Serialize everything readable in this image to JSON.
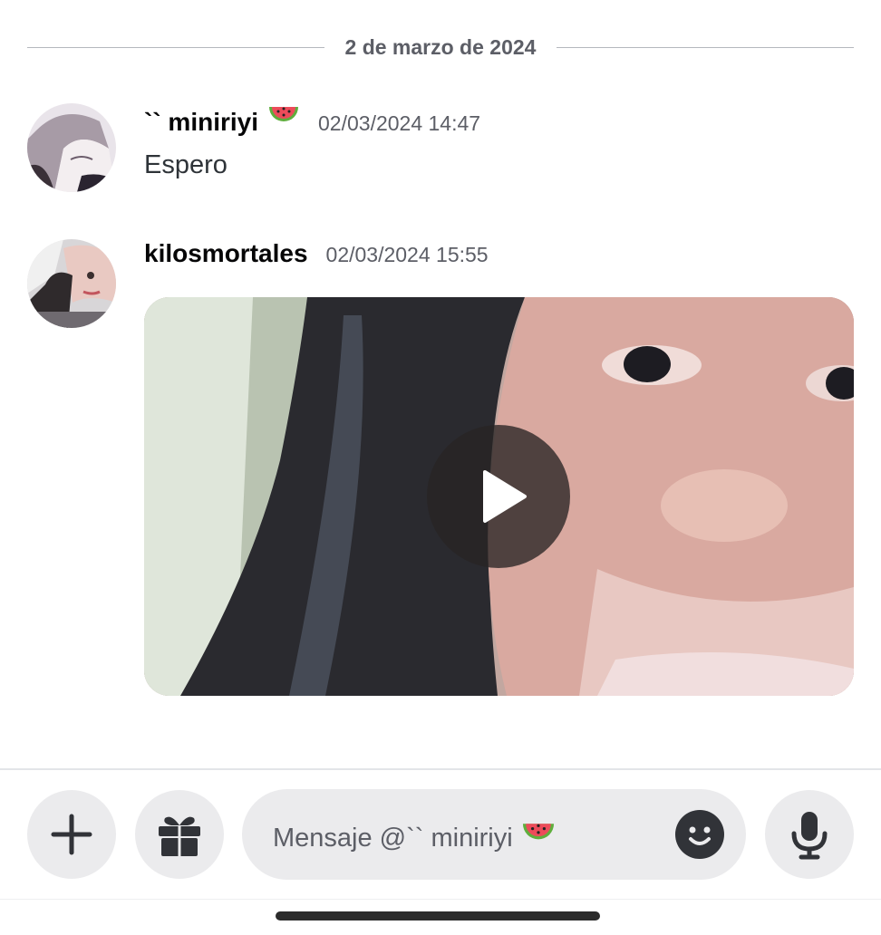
{
  "date_divider": {
    "label": "2 de marzo de 2024"
  },
  "messages": [
    {
      "username": "`` miniriyi",
      "username_emoji": "watermelon-emoji",
      "timestamp": "02/03/2024 14:47",
      "text": "Espero"
    },
    {
      "username": "kilosmortales",
      "timestamp": "02/03/2024 15:55",
      "attachment": {
        "type": "video",
        "play_icon": "play-icon"
      }
    }
  ],
  "composer": {
    "add_icon": "plus-icon",
    "gift_icon": "gift-icon",
    "placeholder": "Mensaje @`` miniriyi",
    "placeholder_emoji": "watermelon-emoji",
    "emoji_icon": "smiley-icon",
    "mic_icon": "microphone-icon"
  },
  "colors": {
    "background": "#ffffff",
    "button_bg": "#ebebed",
    "muted_text": "#5c5e66",
    "icon": "#313338",
    "divider": "#b5b8bd"
  }
}
